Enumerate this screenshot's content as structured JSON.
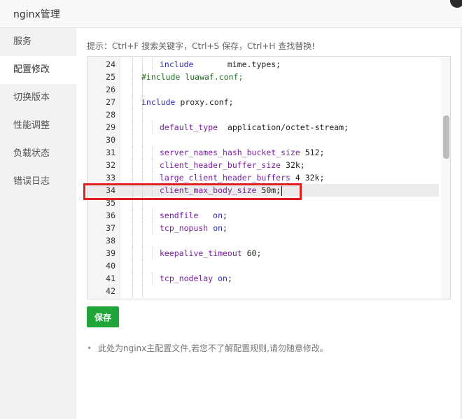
{
  "window": {
    "title": "nginx管理"
  },
  "sidebar": {
    "items": [
      {
        "label": "服务",
        "active": false
      },
      {
        "label": "配置修改",
        "active": true
      },
      {
        "label": "切换版本",
        "active": false
      },
      {
        "label": "性能调整",
        "active": false
      },
      {
        "label": "负载状态",
        "active": false
      },
      {
        "label": "错误日志",
        "active": false
      }
    ]
  },
  "main": {
    "tip": "提示：Ctrl+F 搜索关键字，Ctrl+S 保存，Ctrl+H 查找替换!",
    "save_label": "保存",
    "note": "此处为nginx主配置文件,若您不了解配置规则,请勿随意修改。"
  },
  "editor": {
    "current_line": 34,
    "lines": [
      {
        "num": "24",
        "indent": 2,
        "segments": [
          [
            "include",
            "kw"
          ],
          [
            "       mime.types;",
            "val"
          ]
        ]
      },
      {
        "num": "25",
        "indent": 0,
        "segments": [
          [
            "#include luawaf.conf;",
            "cmt"
          ]
        ]
      },
      {
        "num": "26",
        "indent": 0,
        "segments": []
      },
      {
        "num": "27",
        "indent": 0,
        "segments": [
          [
            "include",
            "kw"
          ],
          [
            " proxy.conf;",
            "val"
          ]
        ]
      },
      {
        "num": "28",
        "indent": 0,
        "segments": []
      },
      {
        "num": "29",
        "indent": 2,
        "segments": [
          [
            "default_type",
            "dir"
          ],
          [
            "  application/octet-stream;",
            "val"
          ]
        ]
      },
      {
        "num": "30",
        "indent": 0,
        "segments": []
      },
      {
        "num": "31",
        "indent": 2,
        "segments": [
          [
            "server_names_hash_bucket_size",
            "dir"
          ],
          [
            " 512;",
            "val"
          ]
        ]
      },
      {
        "num": "32",
        "indent": 2,
        "segments": [
          [
            "client_header_buffer_size",
            "dir"
          ],
          [
            " 32k;",
            "val"
          ]
        ]
      },
      {
        "num": "33",
        "indent": 2,
        "segments": [
          [
            "large_client_header_buffers",
            "dir"
          ],
          [
            " 4 32k;",
            "val"
          ]
        ]
      },
      {
        "num": "34",
        "indent": 2,
        "segments": [
          [
            "client_max_body_size",
            "dir"
          ],
          [
            " 50m;",
            "val"
          ]
        ]
      },
      {
        "num": "35",
        "indent": 0,
        "segments": []
      },
      {
        "num": "36",
        "indent": 2,
        "segments": [
          [
            "sendfile",
            "dir"
          ],
          [
            "   ",
            "val"
          ],
          [
            "on",
            "on"
          ],
          [
            ";",
            "val"
          ]
        ]
      },
      {
        "num": "37",
        "indent": 2,
        "segments": [
          [
            "tcp_nopush",
            "dir"
          ],
          [
            " ",
            "val"
          ],
          [
            "on",
            "on"
          ],
          [
            ";",
            "val"
          ]
        ]
      },
      {
        "num": "38",
        "indent": 0,
        "segments": []
      },
      {
        "num": "39",
        "indent": 2,
        "segments": [
          [
            "keepalive_timeout",
            "dir"
          ],
          [
            " 60;",
            "val"
          ]
        ]
      },
      {
        "num": "40",
        "indent": 0,
        "segments": []
      },
      {
        "num": "41",
        "indent": 2,
        "segments": [
          [
            "tcp_nodelay",
            "dir"
          ],
          [
            " ",
            "val"
          ],
          [
            "on",
            "on"
          ],
          [
            ";",
            "val"
          ]
        ]
      },
      {
        "num": "42",
        "indent": 0,
        "segments": []
      }
    ]
  }
}
